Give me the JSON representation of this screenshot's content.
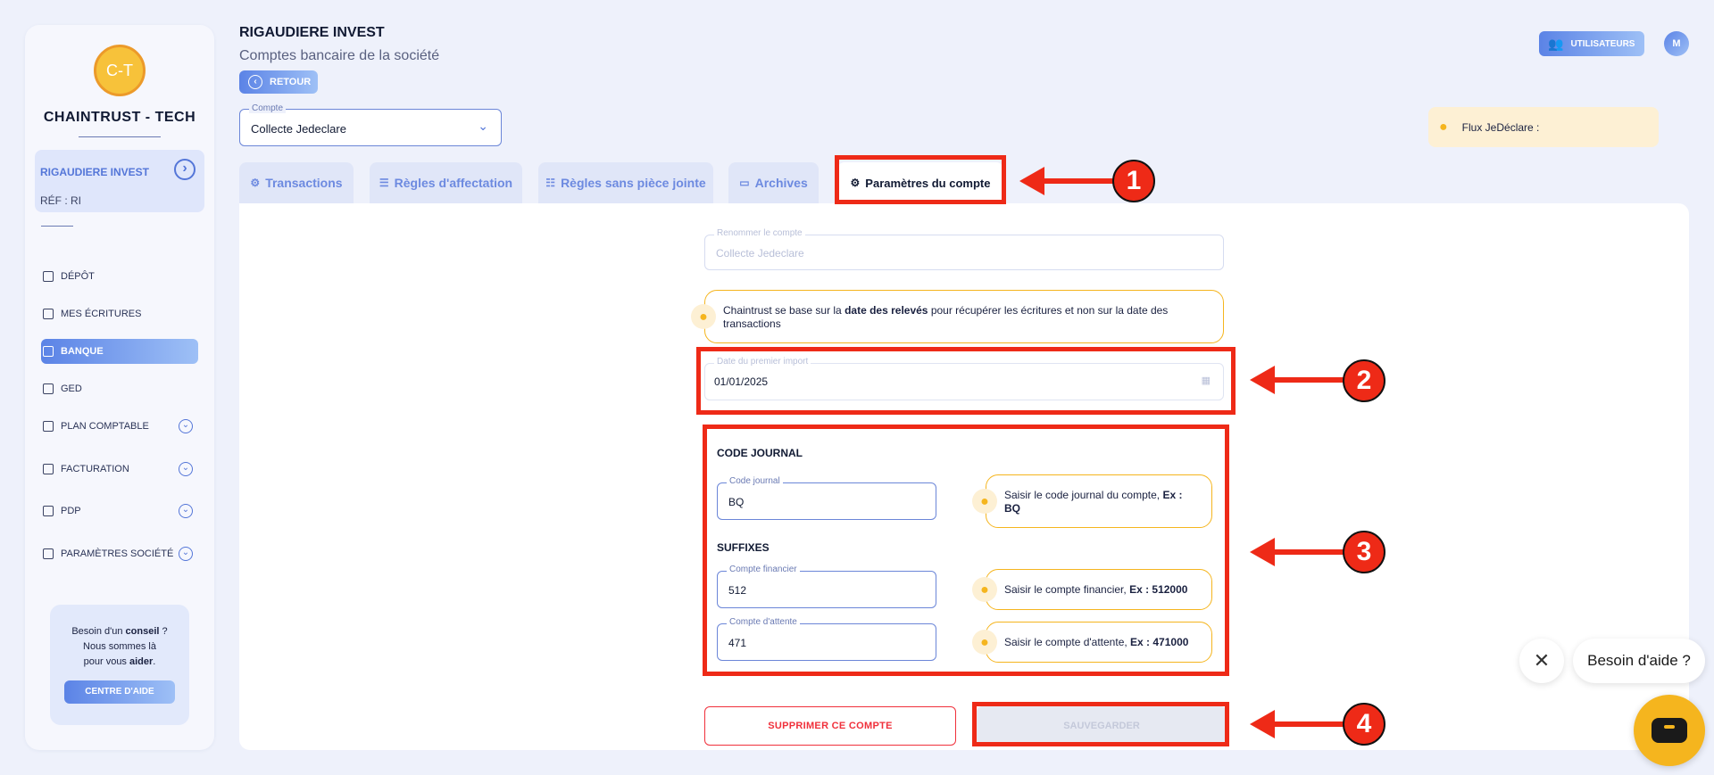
{
  "sidebar": {
    "avatar_initials": "C-T",
    "brand": "CHAINTRUST - TECH",
    "company": {
      "name": "RIGAUDIERE INVEST",
      "ref": "RÉF : RI"
    },
    "nav": [
      {
        "label": "DÉPÔT",
        "icon": "folder-upload-icon"
      },
      {
        "label": "MES ÉCRITURES",
        "icon": "folder-edit-icon"
      },
      {
        "label": "BANQUE",
        "icon": "bank-icon",
        "active": true
      },
      {
        "label": "GED",
        "icon": "document-icon"
      },
      {
        "label": "PLAN COMPTABLE",
        "icon": "ledger-icon",
        "expandable": true
      },
      {
        "label": "FACTURATION",
        "icon": "invoice-icon",
        "expandable": true
      },
      {
        "label": "PDP",
        "icon": "card-icon",
        "expandable": true
      },
      {
        "label": "PARAMÈTRES SOCIÉTÉ",
        "icon": "sliders-icon",
        "expandable": true
      }
    ],
    "help": {
      "line1_a": "Besoin d'un ",
      "line1_b": "conseil",
      "line1_c": " ?",
      "line2": "Nous sommes là",
      "line3_a": "pour vous ",
      "line3_b": "aider",
      "line3_c": ".",
      "button": "CENTRE D'AIDE"
    }
  },
  "header": {
    "title": "RIGAUDIERE INVEST",
    "subtitle": "Comptes bancaire de la société",
    "back": "RETOUR",
    "users": "UTILISATEURS",
    "user_initial": "M",
    "flux": "Flux JeDéclare :"
  },
  "account_select": {
    "label": "Compte",
    "value": "Collecte Jedeclare"
  },
  "tabs": [
    {
      "label": "Transactions",
      "icon": "gear-icon"
    },
    {
      "label": "Règles d'affectation",
      "icon": "list-icon"
    },
    {
      "label": "Règles sans pièce jointe",
      "icon": "filter-icon"
    },
    {
      "label": "Archives",
      "icon": "folder-icon"
    },
    {
      "label": "Paramètres du compte",
      "icon": "settings-icon",
      "active": true
    }
  ],
  "form": {
    "rename": {
      "label": "Renommer le compte",
      "value": "Collecte Jedeclare"
    },
    "info_date": {
      "pre": "Chaintrust se base sur la ",
      "bold": "date des relevés",
      "post": " pour récupérer les écritures et non sur la date des transactions"
    },
    "first_import": {
      "label": "Date du premier import",
      "value": "01/01/2025"
    },
    "code_journal_title": "CODE JOURNAL",
    "code_journal": {
      "label": "Code journal",
      "value": "BQ"
    },
    "code_journal_hint": {
      "pre": "Saisir le code journal du compte, ",
      "bold": "Ex : BQ"
    },
    "suffixes_title": "SUFFIXES",
    "compte_financier": {
      "label": "Compte financier",
      "value": "512"
    },
    "compte_financier_hint": {
      "pre": "Saisir le compte financier, ",
      "bold": "Ex : 512000"
    },
    "compte_attente": {
      "label": "Compte d'attente",
      "value": "471"
    },
    "compte_attente_hint": {
      "pre": "Saisir le compte d'attente, ",
      "bold": "Ex : 471000"
    },
    "delete": "SUPPRIMER CE COMPTE",
    "save": "SAUVEGARDER"
  },
  "annotations": [
    "1",
    "2",
    "3",
    "4"
  ],
  "chat": {
    "bubble": "Besoin d'aide ?"
  },
  "colors": {
    "accent": "#5476d8",
    "annotation": "#ee2a17",
    "warning": "#f5b51e",
    "danger": "#f0303b"
  }
}
